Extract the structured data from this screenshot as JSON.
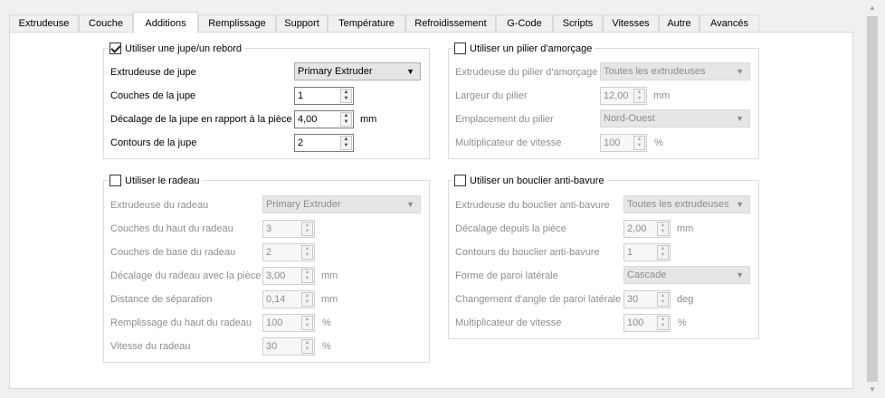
{
  "tabs": [
    "Extrudeuse",
    "Couche",
    "Additions",
    "Remplissage",
    "Support",
    "Température",
    "Refroidissement",
    "G-Code",
    "Scripts",
    "Vitesses",
    "Autre",
    "Avancés"
  ],
  "skirt": {
    "title": "Utiliser une jupe/un rebord",
    "extruder_label": "Extrudeuse de jupe",
    "extruder_value": "Primary Extruder",
    "layers_label": "Couches de la jupe",
    "layers_value": "1",
    "offset_label": "Décalage de la jupe en rapport à la pièce",
    "offset_value": "4,00",
    "offset_unit": "mm",
    "outlines_label": "Contours de la jupe",
    "outlines_value": "2"
  },
  "raft": {
    "title": "Utiliser le radeau",
    "extruder_label": "Extrudeuse du radeau",
    "extruder_value": "Primary Extruder",
    "top_layers_label": "Couches du haut du radeau",
    "top_layers_value": "3",
    "base_layers_label": "Couches de base du radeau",
    "base_layers_value": "2",
    "offset_label": "Décalage du radeau avec la pièce",
    "offset_value": "3,00",
    "offset_unit": "mm",
    "separation_label": "Distance de séparation",
    "separation_value": "0,14",
    "separation_unit": "mm",
    "top_infill_label": "Remplissage du haut du radeau",
    "top_infill_value": "100",
    "top_infill_unit": "%",
    "speed_label": "Vitesse du radeau",
    "speed_value": "30",
    "speed_unit": "%"
  },
  "prime_pillar": {
    "title": "Utiliser un pilier d'amorçage",
    "extruder_label": "Extrudeuse du pilier d'amorçage",
    "extruder_value": "Toutes les extrudeuses",
    "width_label": "Largeur du pilier",
    "width_value": "12,00",
    "width_unit": "mm",
    "location_label": "Emplacement du pilier",
    "location_value": "Nord-Ouest",
    "speed_label": "Multiplicateur de vitesse",
    "speed_value": "100",
    "speed_unit": "%"
  },
  "ooze_shield": {
    "title": "Utiliser un bouclier anti-bavure",
    "extruder_label": "Extrudeuse du bouclier anti-bavure",
    "extruder_value": "Toutes les extrudeuses",
    "offset_label": "Décalage depuis la pièce",
    "offset_value": "2,00",
    "offset_unit": "mm",
    "outlines_label": "Contours du bouclier anti-bavure",
    "outlines_value": "1",
    "wall_shape_label": "Forme de paroi latérale",
    "wall_shape_value": "Cascade",
    "angle_label": "Changement d'angle de paroi latérale",
    "angle_value": "30",
    "angle_unit": "deg",
    "speed_label": "Multiplicateur de vitesse",
    "speed_value": "100",
    "speed_unit": "%"
  }
}
